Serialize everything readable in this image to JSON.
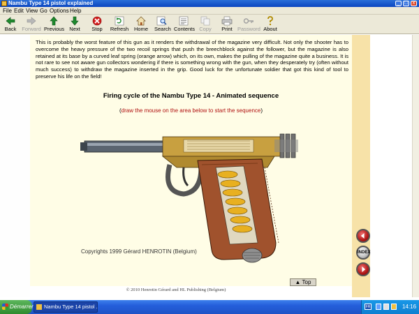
{
  "window": {
    "title": "Nambu Type 14 pistol explained",
    "controls": [
      "_",
      "□",
      "x"
    ]
  },
  "menu": [
    "File",
    "Edit",
    "View",
    "Go",
    "Options",
    "Help"
  ],
  "toolbar": [
    {
      "label": "Back",
      "icon": "back-arrow-icon",
      "enabled": true
    },
    {
      "label": "Forward",
      "icon": "forward-arrow-icon",
      "enabled": false
    },
    {
      "label": "Previous",
      "icon": "up-arrow-icon",
      "enabled": true
    },
    {
      "label": "Next",
      "icon": "down-arrow-icon",
      "enabled": true
    },
    {
      "label": "Stop",
      "icon": "stop-icon",
      "enabled": true
    },
    {
      "label": "Refresh",
      "icon": "refresh-icon",
      "enabled": true
    },
    {
      "label": "Home",
      "icon": "home-icon",
      "enabled": true
    },
    {
      "label": "Search",
      "icon": "search-icon",
      "enabled": true
    },
    {
      "label": "Contents",
      "icon": "contents-icon",
      "enabled": true
    },
    {
      "label": "Copy",
      "icon": "copy-icon",
      "enabled": false
    },
    {
      "label": "Print",
      "icon": "print-icon",
      "enabled": true
    },
    {
      "label": "Password",
      "icon": "key-icon",
      "enabled": false
    },
    {
      "label": "About",
      "icon": "about-icon",
      "enabled": true
    }
  ],
  "article": {
    "paragraph": "This is probably the worst feature of this gun as it renders the withdrawal of the magazine very difficult. Not only the shooter has to overcome the heavy pressure of the two recoil springs that push the breechblock against the follower, but the magazine is also retained at its base by a curved leaf spring (orange arrow) which, on its own, makes the pulling of the magazine quite a business. It is not rare to see not aware gun collectors wondering if there is something wrong with the gun, when they desperately try (often without much success) to withdraw the magazine inserted in the grip. Good luck for the unfortunate soldier that got this kind of tool to preserve his life on the field!",
    "section_title": "Firing cycle of the Nambu Type 14 - Animated sequence",
    "instruction_open": "(",
    "instruction": "draw the mouse on the area below to start the sequence",
    "instruction_close": ")",
    "image_copyright": "Copyrights 1999 Gérard HENROTIN (Belgium)",
    "top_button": "Top",
    "footer": "© 2010 Henrotin Gérard and HL Publishing (Belgium)"
  },
  "side_nav": {
    "index_label": "INDEX"
  },
  "taskbar": {
    "start_label": "Démarrer",
    "task_label": "Nambu Type 14 pistol ...",
    "lang": "FR",
    "clock": "14:16"
  },
  "colors": {
    "page_bg": "#fffde6",
    "side_band": "#f7e2a8",
    "instruction": "#b01010",
    "titlebar": "#0a45c0"
  }
}
